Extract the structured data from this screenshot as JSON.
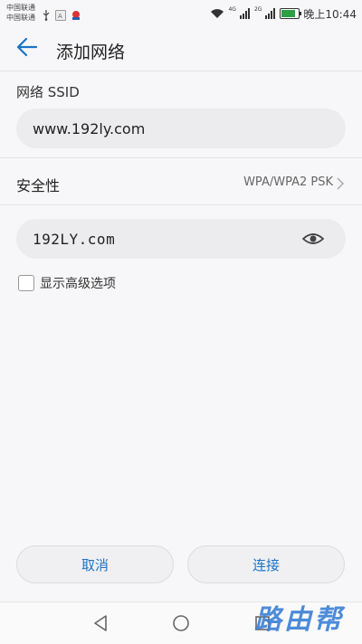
{
  "status_bar": {
    "carrier1": "中国联通",
    "carrier2": "中国联通",
    "net1": "4G",
    "net2": "2G",
    "time": "晚上10:44",
    "icons": [
      "usb-icon",
      "a-icon",
      "notification-icon",
      "wifi-icon",
      "signal-icon",
      "battery-charging-icon"
    ],
    "battery_level": 0.8
  },
  "header": {
    "title": "添加网络",
    "back_icon": "arrow-left-icon"
  },
  "ssid": {
    "label": "网络 SSID",
    "value": "www.192ly.com"
  },
  "security": {
    "label": "安全性",
    "value": "WPA/WPA2 PSK"
  },
  "password": {
    "value": "192LY.com",
    "toggle_icon": "eye-icon"
  },
  "advanced": {
    "label": "显示高级选项",
    "checked": false
  },
  "buttons": {
    "cancel": "取消",
    "connect": "连接"
  },
  "nav": {
    "icons": [
      "back-triangle-icon",
      "home-circle-icon",
      "recent-square-icon"
    ]
  },
  "watermark": "路由帮",
  "colors": {
    "accent": "#1a73c8",
    "background": "#f7f7f9",
    "field": "#ececee",
    "watermark": "#3b7fd6"
  }
}
